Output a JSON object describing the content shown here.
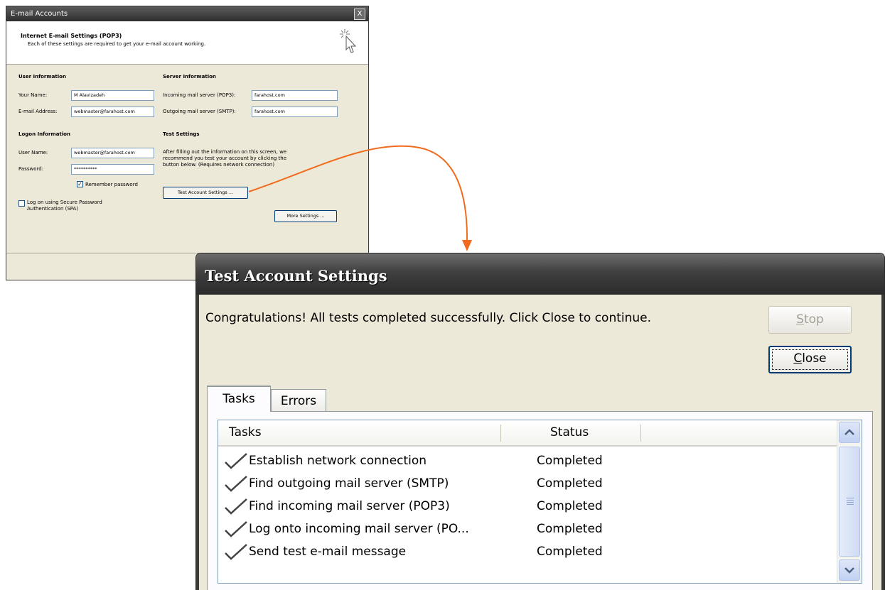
{
  "email_dialog": {
    "title": "E-mail Accounts",
    "close_glyph": "X",
    "header_title": "Internet E-mail Settings (POP3)",
    "header_subtitle": "Each of these settings are required to get your e-mail account working.",
    "user_info": {
      "heading": "User Information",
      "name_label": "Your Name:",
      "name_value": "M Alavizadeh",
      "email_label": "E-mail Address:",
      "email_value": "webmaster@farahost.com"
    },
    "server_info": {
      "heading": "Server Information",
      "incoming_label": "Incoming mail server (POP3):",
      "incoming_value": "farahost.com",
      "outgoing_label": "Outgoing mail server (SMTP):",
      "outgoing_value": "farahost.com"
    },
    "logon_info": {
      "heading": "Logon Information",
      "username_label": "User Name:",
      "username_value": "webmaster@farahost.com",
      "password_label": "Password:",
      "password_value": "**********",
      "remember_label": "Remember password",
      "remember_checked": true,
      "spa_label_line1": "Log on using Secure Password",
      "spa_label_line2": "Authentication (SPA)",
      "spa_checked": false
    },
    "test_settings": {
      "heading": "Test Settings",
      "description_line1": "After filling out the information on this screen, we",
      "description_line2": "recommend you test your account by clicking the",
      "description_line3": "button below. (Requires network connection)",
      "test_button": "Test Account Settings ...",
      "more_button": "More Settings ..."
    }
  },
  "test_dialog": {
    "title": "Test Account Settings",
    "message": "Congratulations! All tests completed successfully. Click Close to continue.",
    "stop_button": {
      "first": "S",
      "rest": "top"
    },
    "close_button": {
      "first": "C",
      "rest": "lose"
    },
    "tabs": [
      "Tasks",
      "Errors"
    ],
    "columns": [
      "Tasks",
      "Status"
    ],
    "rows": [
      {
        "task": "Establish network connection",
        "status": "Completed"
      },
      {
        "task": "Find outgoing mail server (SMTP)",
        "status": "Completed"
      },
      {
        "task": "Find incoming mail server (POP3)",
        "status": "Completed"
      },
      {
        "task": "Log onto incoming mail server (PO...",
        "status": "Completed"
      },
      {
        "task": "Send test e-mail message",
        "status": "Completed"
      }
    ]
  },
  "colors": {
    "connector": "#f26b1d",
    "titlebar_dark": "#2b2b2b",
    "dialog_face": "#ece9d8"
  }
}
